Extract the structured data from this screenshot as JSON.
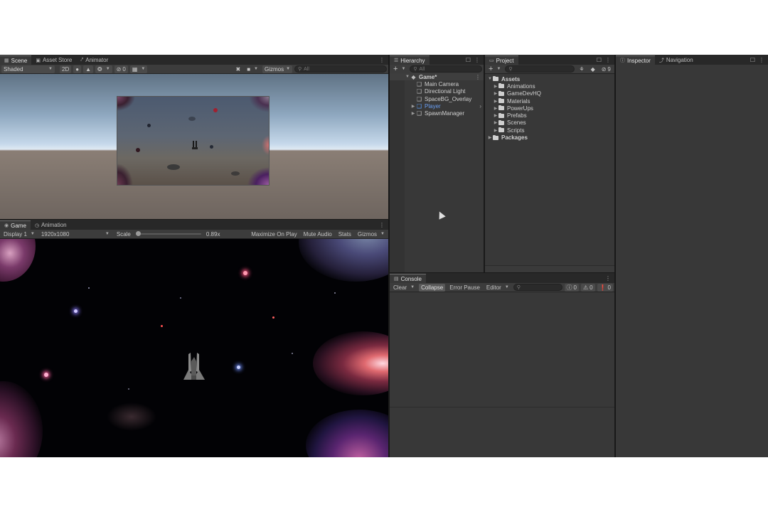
{
  "scene_panel": {
    "tabs": [
      {
        "label": "Scene",
        "icon": "grid-icon"
      },
      {
        "label": "Asset Store",
        "icon": "bag-icon"
      },
      {
        "label": "Animator",
        "icon": "animator-icon"
      }
    ],
    "shading_mode": "Shaded",
    "btn_2d": "2D",
    "hidden_count": "0",
    "gizmos_label": "Gizmos",
    "search_placeholder": "All"
  },
  "game_panel": {
    "tabs": [
      {
        "label": "Game",
        "icon": "gamepad-icon"
      },
      {
        "label": "Animation",
        "icon": "clock-icon"
      }
    ],
    "display": "Display 1",
    "resolution": "1920x1080",
    "scale_label": "Scale",
    "scale_value": "0.89x",
    "scale_fraction": 0.0,
    "maximize_on_play": "Maximize On Play",
    "mute_audio": "Mute Audio",
    "stats": "Stats",
    "gizmos": "Gizmos"
  },
  "hierarchy": {
    "tab_label": "Hierarchy",
    "search_placeholder": "All",
    "scene_name": "Game*",
    "items": [
      {
        "label": "Main Camera",
        "expandable": false,
        "selected_color": false
      },
      {
        "label": "Directional Light",
        "expandable": false,
        "selected_color": false
      },
      {
        "label": "SpaceBG_Overlay",
        "expandable": false,
        "selected_color": false
      },
      {
        "label": "Player",
        "expandable": true,
        "selected_color": true
      },
      {
        "label": "SpawnManager",
        "expandable": true,
        "selected_color": false
      }
    ]
  },
  "project": {
    "tab_label": "Project",
    "hidden_count": "9",
    "root_assets": "Assets",
    "folders": [
      "Animations",
      "GameDevHQ",
      "Materials",
      "PowerUps",
      "Prefabs",
      "Scenes",
      "Scripts"
    ],
    "root_packages": "Packages"
  },
  "inspector": {
    "tabs": [
      {
        "label": "Inspector",
        "icon": "info-icon"
      },
      {
        "label": "Navigation",
        "icon": "navigation-icon"
      }
    ]
  },
  "console": {
    "tab_label": "Console",
    "clear": "Clear",
    "collapse": "Collapse",
    "error_pause": "Error Pause",
    "editor": "Editor",
    "log_count": "0",
    "warning_count": "0",
    "error_count": "0"
  },
  "colors": {
    "selected_object": "#6a9ff3",
    "panel_bg": "#383838",
    "tabbar_bg": "#282828"
  }
}
